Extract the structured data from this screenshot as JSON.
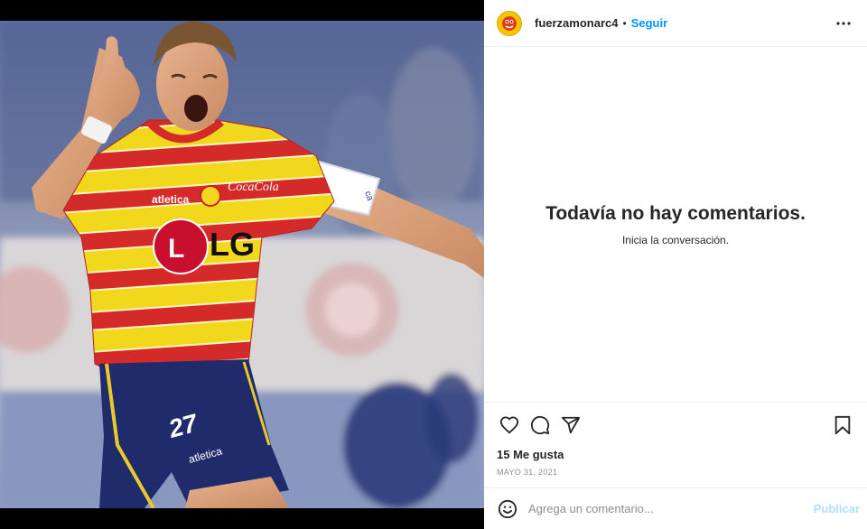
{
  "post": {
    "author": {
      "username": "fuerzamonarc4",
      "avatar_icon": "monarcas-mascot-icon"
    },
    "follow_label": "Seguir",
    "separator": "•",
    "more_icon": "more-horizontal-icon",
    "media": {
      "jersey_brands": [
        "atletica",
        "coca-cola",
        "LG"
      ]
    },
    "comments": {
      "empty_title": "Todavía no hay comentarios.",
      "empty_subtitle": "Inicia la conversación."
    },
    "actions": {
      "like_icon": "heart-icon",
      "comment_icon": "comment-icon",
      "share_icon": "send-icon",
      "save_icon": "bookmark-icon"
    },
    "likes_text": "15 Me gusta",
    "date_text": "MAYO 31, 2021",
    "comment_box": {
      "emoji_icon": "emoji-icon",
      "placeholder": "Agrega un comentario...",
      "publish_label": "Publicar"
    }
  },
  "colors": {
    "follow": "#0095f6",
    "publish_disabled": "#b2dffc",
    "jersey_yellow": "#f2d81c",
    "jersey_red": "#d42a2a",
    "shorts_navy": "#1f2b6b"
  }
}
